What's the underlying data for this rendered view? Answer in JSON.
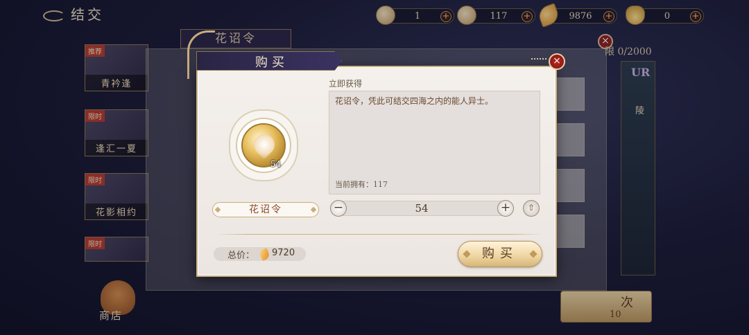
{
  "header": {
    "title": "结交",
    "resources": [
      {
        "icon": "token-icon",
        "value": "1"
      },
      {
        "icon": "token-icon",
        "value": "117"
      },
      {
        "icon": "leaf-currency-icon",
        "value": "9876"
      },
      {
        "icon": "ingot-icon",
        "value": "0"
      }
    ]
  },
  "background": {
    "panel_title": "花诏令",
    "limit_text": "限 0/2000",
    "cards": [
      {
        "tag": "推荐",
        "name": "青衿逢"
      },
      {
        "tag": "限时",
        "name": "逢汇一夏"
      },
      {
        "tag": "限时",
        "name": "花影相约"
      },
      {
        "tag": "限时",
        "name": ""
      }
    ],
    "side_tag": "UR",
    "side_name": "陵",
    "count_label": "次",
    "count_value": "10",
    "shop_label": "商店"
  },
  "modal": {
    "title": "购买",
    "gain_label": "立即获得",
    "description": "花诏令，凭此可结交四海之内的能人异士。",
    "owned_text": "当前拥有：117",
    "item_name": "花诏令",
    "item_quantity": "54",
    "quantity": "54",
    "minus": "−",
    "plus": "+",
    "max_icon": "max-icon",
    "total_label": "总价：",
    "total_value": "9720",
    "buy_label": "购买",
    "close": "×"
  }
}
